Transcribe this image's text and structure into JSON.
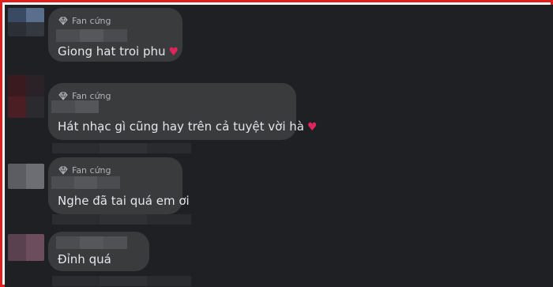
{
  "comments": [
    {
      "badge": "Fan cứng",
      "text": "Giong hat troi phu",
      "emoji": "♥"
    },
    {
      "badge": "Fan cứng",
      "text": "Hát nhạc gì cũng hay trên cả tuyệt vời hà",
      "emoji": "♥"
    },
    {
      "badge": "Fan cứng",
      "text": "Nghe đã tai quá em ơi",
      "emoji": ""
    },
    {
      "badge": "",
      "text": "Đỉnh quá",
      "emoji": ""
    }
  ],
  "colors": {
    "background": "#1f2023",
    "bubble": "#3a3b3d",
    "text": "#e4e6eb",
    "badge": "#b0b3b8",
    "heart": "#e0245e",
    "frame": "#e11d1d"
  },
  "icons": {
    "badge_icon": "diamond-icon"
  }
}
